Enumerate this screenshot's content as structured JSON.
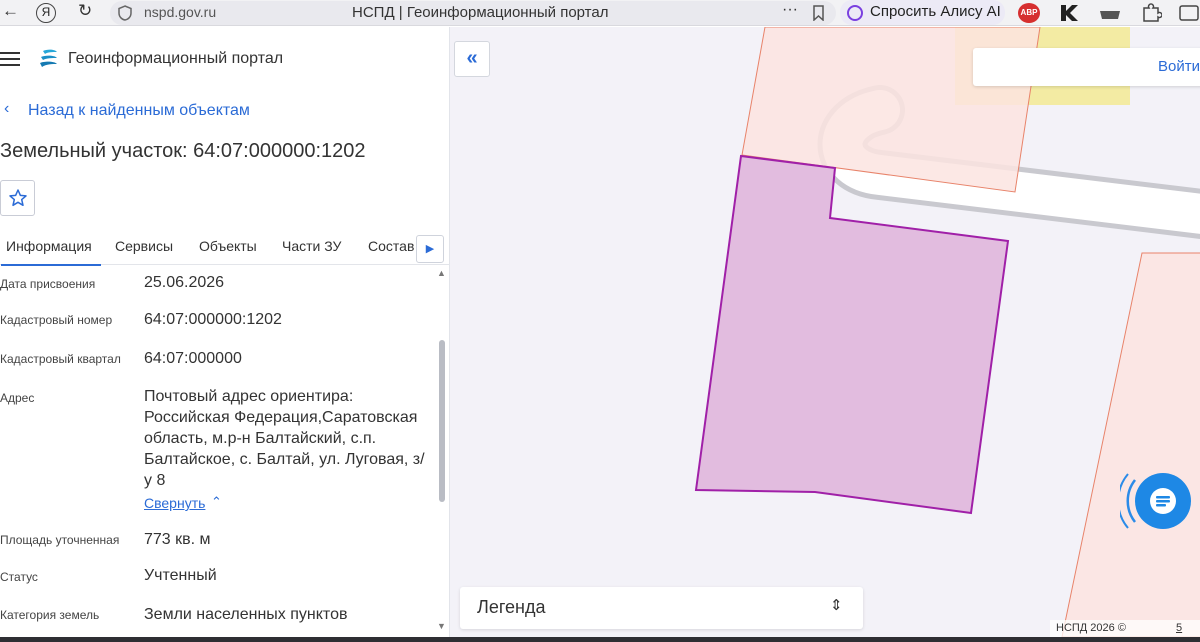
{
  "browser": {
    "url": "nspd.gov.ru",
    "tab_title": "НСПД | Геоинформационный портал",
    "alice_label": "Спросить Алису AI",
    "abp_label": "ABP",
    "yandex_glyph": "Я",
    "more_glyph": "···"
  },
  "header": {
    "app_title": "Геоинформационный портал",
    "back_label": "Назад к найденным объектам",
    "page_title": "Земельный участок: 64:07:000000:1202"
  },
  "tabs": [
    {
      "label": "Информация",
      "active": true
    },
    {
      "label": "Сервисы"
    },
    {
      "label": "Объекты"
    },
    {
      "label": "Части ЗУ"
    },
    {
      "label": "Состав"
    }
  ],
  "info": [
    {
      "label": "Дата присвоения",
      "value": "25.06.2026"
    },
    {
      "label": "Кадастровый номер",
      "value": "64:07:000000:1202"
    },
    {
      "label": "Кадастровый квартал",
      "value": "64:07:000000"
    },
    {
      "label": "Адрес",
      "value_lines": [
        "Почтовый адрес ориентира:",
        "Российская Федерация,Саратовская",
        "область, м.р-н Балтайский, с.п.",
        "Балтайское, с. Балтай, ул. Луговая, з/",
        "у 8"
      ]
    },
    {
      "label": "Площадь уточненная",
      "value": "773 кв. м"
    },
    {
      "label": "Статус",
      "value": "Учтенный"
    },
    {
      "label": "Категория земель",
      "value": "Земли населенных пунктов"
    }
  ],
  "collapse_label": "Свернуть",
  "map": {
    "search_label": "Войти",
    "legend_label": "Легенда",
    "copyright": "НСПД 2026 ©",
    "scale_partial": "5"
  },
  "colors": {
    "accent": "#2b6bd6",
    "selected_fill": "#e2bcdf",
    "selected_stroke": "#a020a8",
    "parcel_fill": "#fbe4e0",
    "parcel_stroke": "#e8836a",
    "chat_button": "#1e88e5"
  }
}
